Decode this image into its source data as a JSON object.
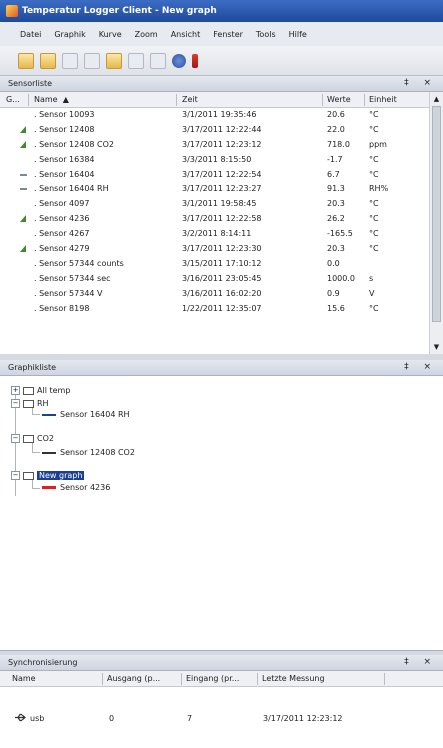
{
  "window": {
    "title": "Temperatur Logger Client - New graph"
  },
  "menu": [
    "Datei",
    "Graphik",
    "Kurve",
    "Zoom",
    "Ansicht",
    "Fenster",
    "Tools",
    "Hilfe"
  ],
  "sensor_panel": {
    "title": "Sensorliste",
    "controls": "‡ ×",
    "columns": {
      "graph": "G...",
      "name": "Name",
      "sort_icon": "sort-ascending-icon",
      "time": "Zeit",
      "value": "Werte",
      "unit": "Einheit"
    },
    "rows": [
      {
        "name": "Sensor 10093",
        "time": "3/1/2011 19:35:46",
        "value": "20.6",
        "unit": "°C",
        "icon": ""
      },
      {
        "name": "Sensor 12408",
        "time": "3/17/2011 12:22:44",
        "value": "22.0",
        "unit": "°C",
        "icon": "up"
      },
      {
        "name": "Sensor 12408 CO2",
        "time": "3/17/2011 12:23:12",
        "value": "718.0",
        "unit": "ppm",
        "icon": "up"
      },
      {
        "name": "Sensor 16384",
        "time": "3/3/2011 8:15:50",
        "value": "-1.7",
        "unit": "°C",
        "icon": ""
      },
      {
        "name": "Sensor 16404",
        "time": "3/17/2011 12:22:54",
        "value": "6.7",
        "unit": "°C",
        "icon": "flat"
      },
      {
        "name": "Sensor 16404 RH",
        "time": "3/17/2011 12:23:27",
        "value": "91.3",
        "unit": "RH%",
        "icon": "flat"
      },
      {
        "name": "Sensor 4097",
        "time": "3/1/2011 19:58:45",
        "value": "20.3",
        "unit": "°C",
        "icon": ""
      },
      {
        "name": "Sensor 4236",
        "time": "3/17/2011 12:22:58",
        "value": "26.2",
        "unit": "°C",
        "icon": "up"
      },
      {
        "name": "Sensor 4267",
        "time": "3/2/2011 8:14:11",
        "value": "-165.5",
        "unit": "°C",
        "icon": ""
      },
      {
        "name": "Sensor 4279",
        "time": "3/17/2011 12:23:30",
        "value": "20.3",
        "unit": "°C",
        "icon": "up"
      },
      {
        "name": "Sensor 57344 counts",
        "time": "3/15/2011 17:10:12",
        "value": "0.0",
        "unit": "",
        "icon": ""
      },
      {
        "name": "Sensor 57344 sec",
        "time": "3/16/2011 23:05:45",
        "value": "1000.0",
        "unit": "s",
        "icon": ""
      },
      {
        "name": "Sensor 57344 V",
        "time": "3/16/2011 16:02:20",
        "value": "0.9",
        "unit": "V",
        "icon": ""
      },
      {
        "name": "Sensor 8198",
        "time": "1/22/2011 12:35:07",
        "value": "15.6",
        "unit": "°C",
        "icon": ""
      }
    ]
  },
  "graph_panel": {
    "title": "Graphikliste",
    "controls": "‡ ×",
    "nodes": [
      {
        "label": "All temp",
        "expander": "+",
        "selected": false
      },
      {
        "label": "RH",
        "expander": "−",
        "selected": false
      },
      {
        "label": "Sensor 16404 RH",
        "line_color": "#1f3f8f",
        "selected": false
      },
      {
        "label": "CO2",
        "expander": "−",
        "selected": false
      },
      {
        "label": "Sensor 12408 CO2",
        "line_color": "#333333",
        "selected": false
      },
      {
        "label": "New graph",
        "expander": "−",
        "selected": true
      },
      {
        "label": "Sensor 4236",
        "line_color": "#e02020",
        "selected": false
      }
    ]
  },
  "sync_panel": {
    "title": "Synchronisierung",
    "controls": "‡ ×",
    "columns": {
      "name": "Name",
      "out": "Ausgang (p...",
      "in": "Eingang (pr...",
      "last": "Letzte Messung"
    },
    "rows": [
      {
        "name": "usb",
        "out": "0",
        "in": "7",
        "last": "3/17/2011 12:23:12"
      }
    ]
  }
}
